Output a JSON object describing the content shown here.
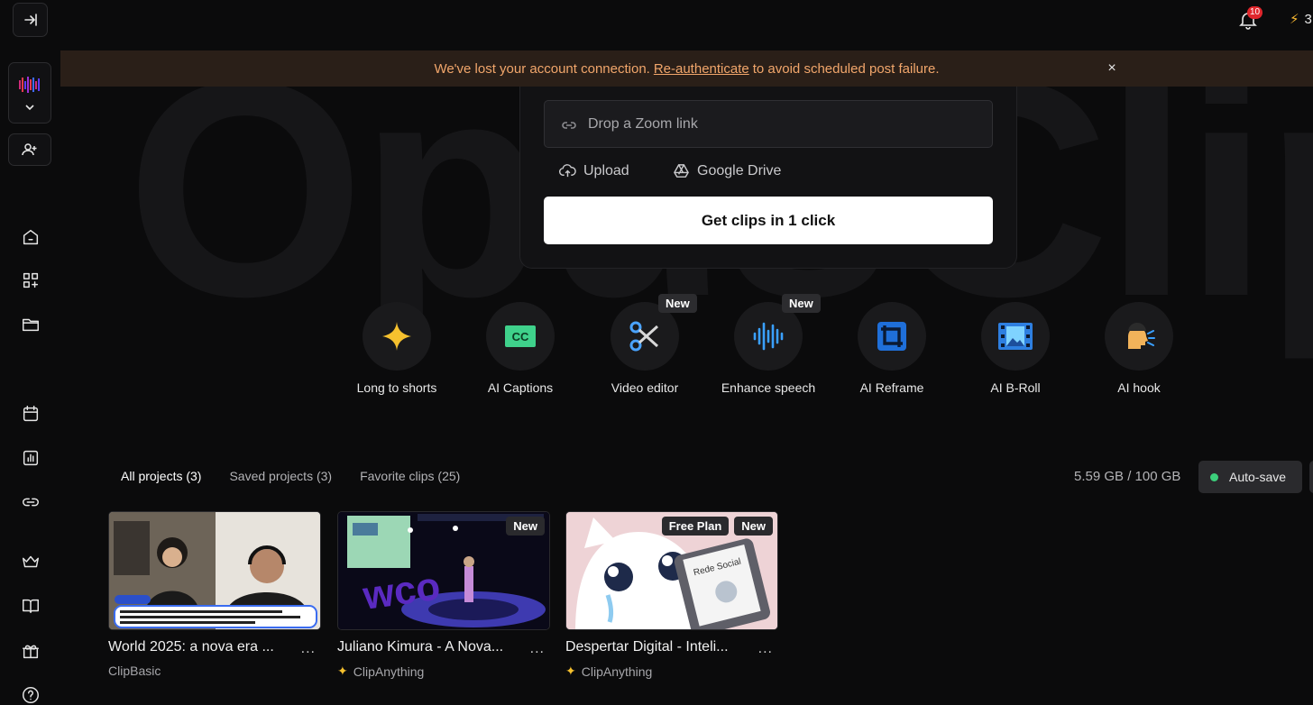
{
  "notifications": {
    "count": "10"
  },
  "credits": {
    "value": "3"
  },
  "banner": {
    "prefix": "We've lost your account connection.",
    "link": "Re-authenticate",
    "suffix": "to avoid scheduled post failure.",
    "close": "×"
  },
  "hero": {
    "text": "OpusClip"
  },
  "upload": {
    "zoom_placeholder": "Drop a Zoom link",
    "upload_label": "Upload",
    "drive_label": "Google Drive",
    "cta_label": "Get clips in 1 click"
  },
  "tools": [
    {
      "label": "Long to shorts",
      "icon": "sparkle-icon",
      "new": ""
    },
    {
      "label": "AI Captions",
      "icon": "cc-icon",
      "new": ""
    },
    {
      "label": "Video editor",
      "icon": "scissors-icon",
      "new": "New"
    },
    {
      "label": "Enhance speech",
      "icon": "waveform-icon",
      "new": "New"
    },
    {
      "label": "AI Reframe",
      "icon": "crop-icon",
      "new": ""
    },
    {
      "label": "AI B-Roll",
      "icon": "film-icon",
      "new": ""
    },
    {
      "label": "AI hook",
      "icon": "speaking-head-icon",
      "new": ""
    }
  ],
  "tabs": [
    {
      "label": "All projects (3)",
      "active": true
    },
    {
      "label": "Saved projects (3)",
      "active": false
    },
    {
      "label": "Favorite clips (25)",
      "active": false
    }
  ],
  "storage": {
    "label": "5.59 GB / 100 GB"
  },
  "autosave": {
    "label": "Auto-save",
    "status_color": "#3ccf7b"
  },
  "projects": [
    {
      "title": "World 2025: a nova era ...",
      "plan": "ClipBasic",
      "badges": [],
      "more": "..."
    },
    {
      "title": "Juliano Kimura - A Nova...",
      "plan": "ClipAnything",
      "badges": [
        "New"
      ],
      "more": "..."
    },
    {
      "title": "Despertar Digital - Inteli...",
      "plan": "ClipAnything",
      "badges": [
        "Free Plan",
        "New"
      ],
      "more": "..."
    }
  ]
}
